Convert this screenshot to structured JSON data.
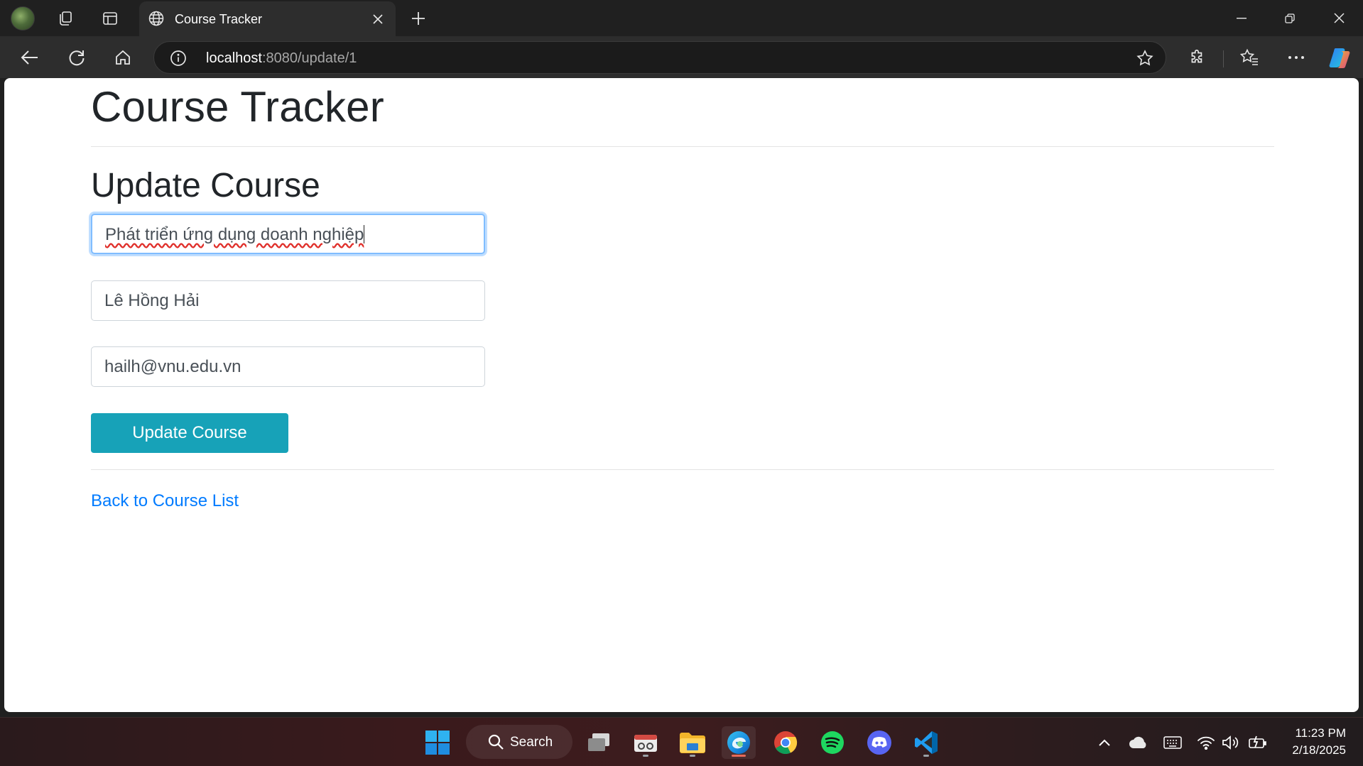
{
  "browser": {
    "tab_title": "Course Tracker",
    "address": {
      "host": "localhost",
      "path": ":8080/update/1"
    }
  },
  "page": {
    "site_title": "Course Tracker",
    "form_title": "Update Course",
    "fields": {
      "course_name": "Phát triển ứng dụng doanh nghiệp",
      "instructor": "Lê Hồng Hải",
      "email": "hailh@vnu.edu.vn"
    },
    "submit_label": "Update Course",
    "back_link": "Back to Course List"
  },
  "taskbar": {
    "search_label": "Search",
    "time": "11:23 PM",
    "date": "2/18/2025"
  },
  "colors": {
    "button": "#17a2b8",
    "link": "#007bff",
    "focus": "#80bdff"
  }
}
